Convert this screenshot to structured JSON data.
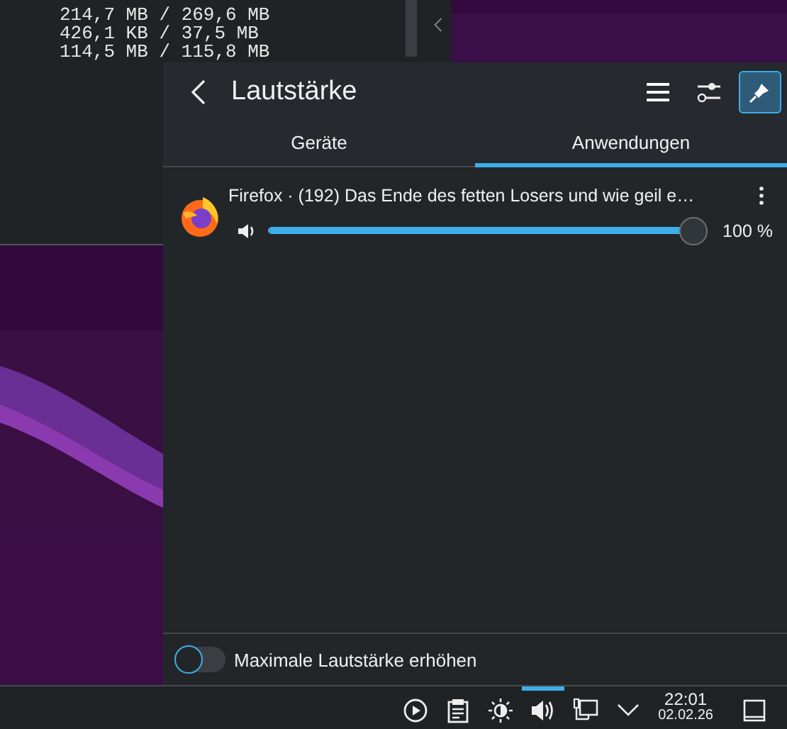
{
  "terminal": {
    "lines": [
      "214,7 MB / 269,6 MB",
      "426,1 KB / 37,5 MB",
      "114,5 MB / 115,8 MB"
    ]
  },
  "popup": {
    "title": "Lautstärke",
    "pinned": true,
    "tabs": [
      {
        "label": "Geräte",
        "selected": false
      },
      {
        "label": "Anwendungen",
        "selected": true
      }
    ],
    "streams": [
      {
        "name": "Firefox · (192) Das Ende des fetten Losers und wie geil e…",
        "level": 1.0,
        "reading": "100 %"
      }
    ],
    "footer": {
      "label": "Maximale Lautstärke erhöhen",
      "on": false
    }
  },
  "taskbar": {
    "tray": [
      {
        "kind": "play",
        "selected": false
      },
      {
        "kind": "clipboard",
        "selected": false
      },
      {
        "kind": "brightness",
        "selected": false
      },
      {
        "kind": "volume",
        "selected": true
      },
      {
        "kind": "network",
        "selected": false
      },
      {
        "kind": "expand",
        "selected": false
      }
    ],
    "time": "22:01",
    "date": "02.02.26"
  }
}
